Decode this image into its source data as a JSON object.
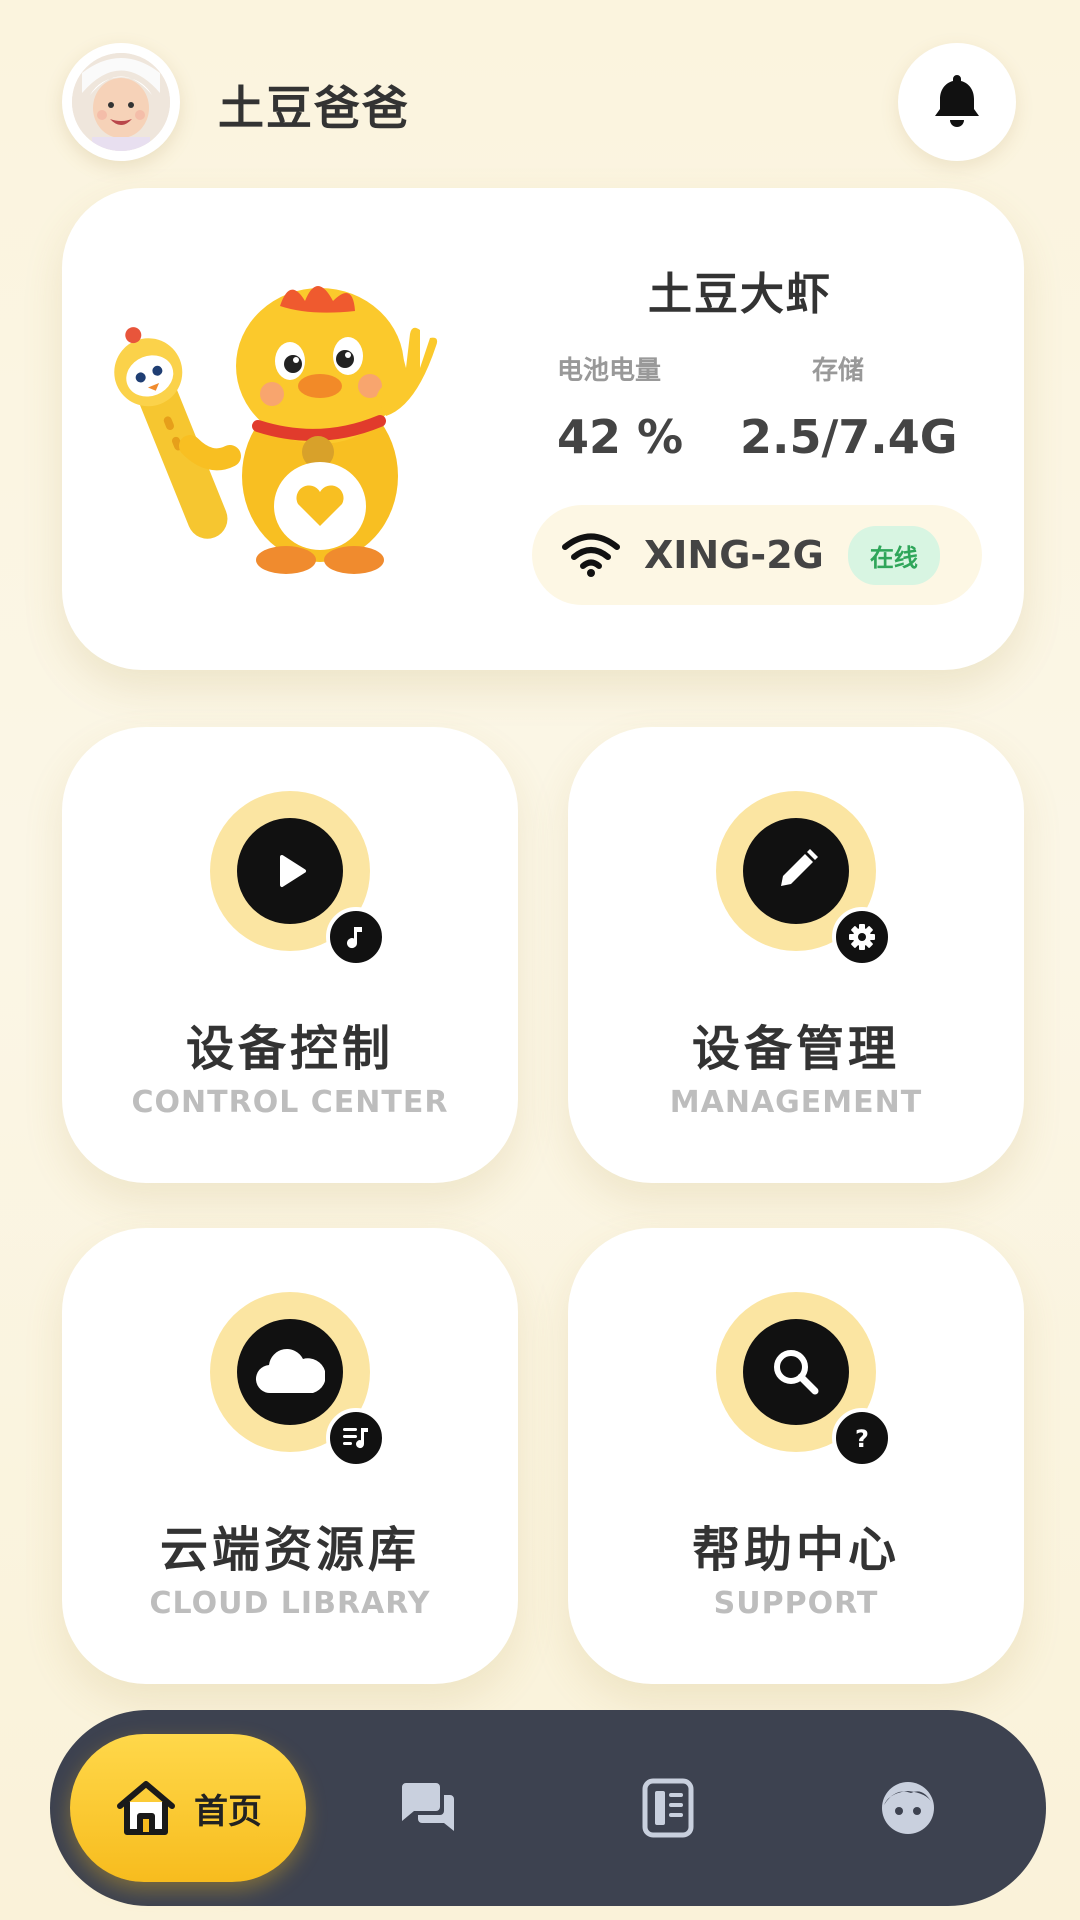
{
  "header": {
    "username": "土豆爸爸",
    "avatar_icon": "avatar-photo",
    "notification_icon": "bell-icon"
  },
  "device": {
    "name": "土豆大虾",
    "battery_label": "电池电量",
    "battery_value": "42 %",
    "storage_label": "存储",
    "storage_value": "2.5/7.4G",
    "wifi_icon": "wifi-icon",
    "wifi_name": "XING-2G",
    "status": "在线",
    "status_color": "#2fa65a"
  },
  "tiles": [
    {
      "title": "设备控制",
      "subtitle": "CONTROL CENTER",
      "icon": "play-icon",
      "badge_icon": "music-note-icon"
    },
    {
      "title": "设备管理",
      "subtitle": "MANAGEMENT",
      "icon": "pencil-icon",
      "badge_icon": "gear-icon"
    },
    {
      "title": "云端资源库",
      "subtitle": "CLOUD LIBRARY",
      "icon": "cloud-icon",
      "badge_icon": "playlist-icon"
    },
    {
      "title": "帮助中心",
      "subtitle": "SUPPORT",
      "icon": "search-icon",
      "badge_icon": "question-icon"
    }
  ],
  "nav": {
    "home_label": "首页",
    "items": [
      "home-icon",
      "chat-icon",
      "document-icon",
      "profile-icon"
    ]
  },
  "colors": {
    "accent": "#f7bc1e",
    "icon_ring": "#fbe5a2",
    "nav_bg": "#3d4250",
    "nav_icon": "#c9d0de"
  }
}
